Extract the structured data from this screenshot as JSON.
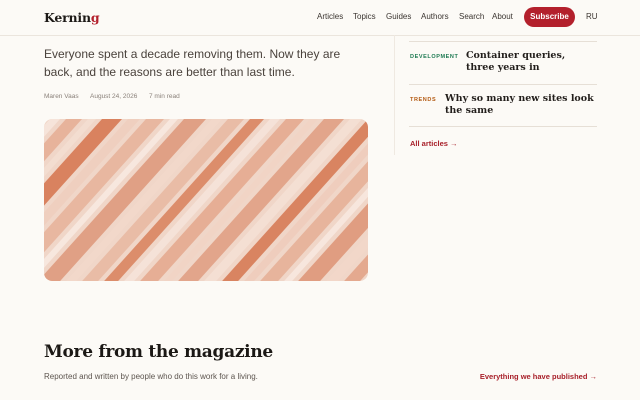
{
  "brand": {
    "name_main": "Kernin",
    "name_accent": "g",
    "accent_color": "#b3202c"
  },
  "nav": {
    "items": [
      "Articles",
      "Topics",
      "Guides",
      "Authors",
      "Search",
      "About"
    ],
    "subscribe_label": "Subscribe",
    "language": "RU"
  },
  "article": {
    "lede": "Everyone spent a decade removing them. Now they are back, and the reasons are better than last time.",
    "author": "Maren Vaas",
    "date": "August 24, 2026",
    "read_time": "7 min read"
  },
  "sidebar": {
    "items": [
      {
        "tag": "DEVELOPMENT",
        "tag_color": "#1d7a52",
        "title": "Container queries, three years in"
      },
      {
        "tag": "TRENDS",
        "tag_color": "#b35a12",
        "title": "Why so many new sites look the same"
      }
    ],
    "all_articles_label": "All articles →"
  },
  "section": {
    "title": "More from the magazine",
    "subtitle": "Reported and written by people who do this work for a living.",
    "link_label": "Everything we have published →"
  }
}
